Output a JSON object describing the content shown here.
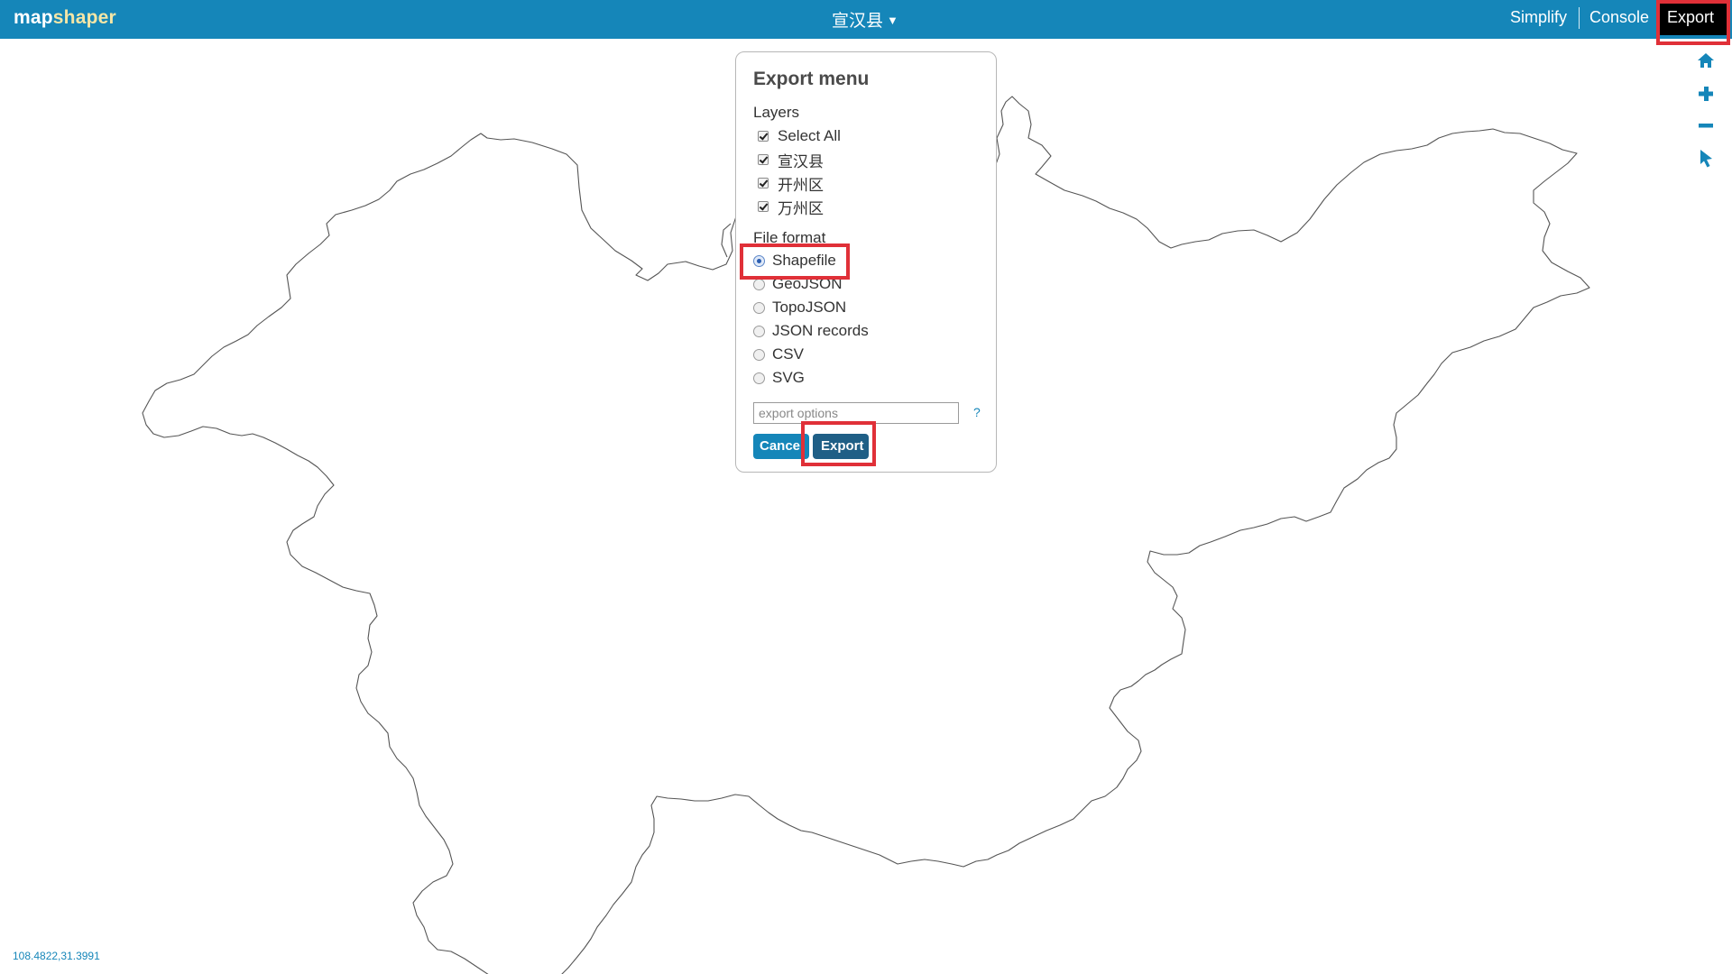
{
  "app": {
    "logo_part1": "map",
    "logo_part2": "shaper",
    "current_layer": "宣汉县",
    "current_layer_arrow": "▼"
  },
  "nav": {
    "simplify": "Simplify",
    "console": "Console",
    "export": "Export"
  },
  "tools": [
    "home-icon",
    "zoom-in-icon",
    "zoom-out-icon",
    "pointer-icon"
  ],
  "export_menu": {
    "title": "Export menu",
    "layers_label": "Layers",
    "layers": [
      {
        "label": "Select All",
        "checked": true
      },
      {
        "label": "宣汉县",
        "checked": true
      },
      {
        "label": "开州区",
        "checked": true
      },
      {
        "label": "万州区",
        "checked": true
      }
    ],
    "format_label": "File format",
    "formats": [
      {
        "label": "Shapefile",
        "selected": true
      },
      {
        "label": "GeoJSON",
        "selected": false
      },
      {
        "label": "TopoJSON",
        "selected": false
      },
      {
        "label": "JSON records",
        "selected": false
      },
      {
        "label": "CSV",
        "selected": false
      },
      {
        "label": "SVG",
        "selected": false
      }
    ],
    "options_placeholder": "export options",
    "help": "?",
    "cancel": "Cancel",
    "export": "Export"
  },
  "coordinates": "108.4822,31.3991",
  "colors": {
    "topbar": "#1586b9",
    "logo_accent": "#f5e6a6",
    "highlight": "#e03038",
    "export_button": "#1f5f86"
  }
}
